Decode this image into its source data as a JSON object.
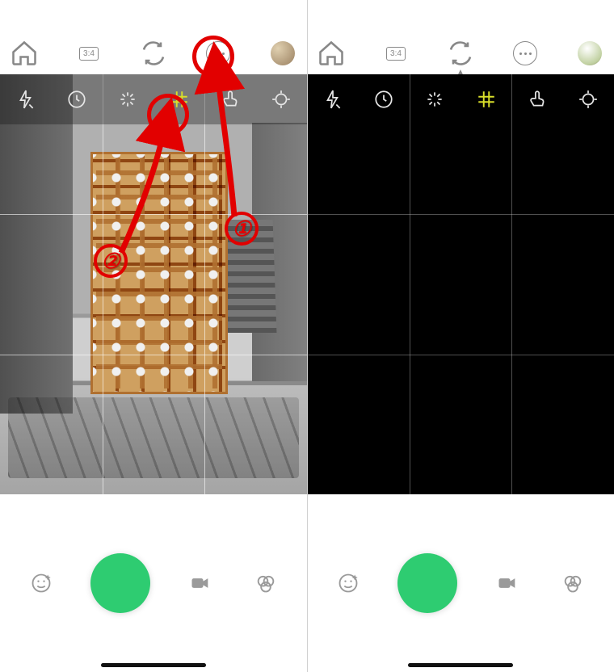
{
  "top_bar": {
    "home": "home-icon",
    "ratio_label": "3:4",
    "flip": "flip-camera-icon",
    "more": "more-icon",
    "avatar": "avatar"
  },
  "tools": {
    "flash": "flash-off-icon",
    "timer": "timer-icon",
    "burst": "burst-icon",
    "grid": "grid-icon",
    "touch": "touch-shoot-icon",
    "focus": "focus-icon"
  },
  "bottom": {
    "sticker": "sticker-icon",
    "shutter": "shutter-button",
    "video": "video-icon",
    "filters": "filters-icon"
  },
  "annotations": {
    "n1": "①",
    "n2": "②"
  },
  "colors": {
    "accent": "#2ecc71",
    "active": "#d8de2a",
    "annotation": "#e20000"
  }
}
